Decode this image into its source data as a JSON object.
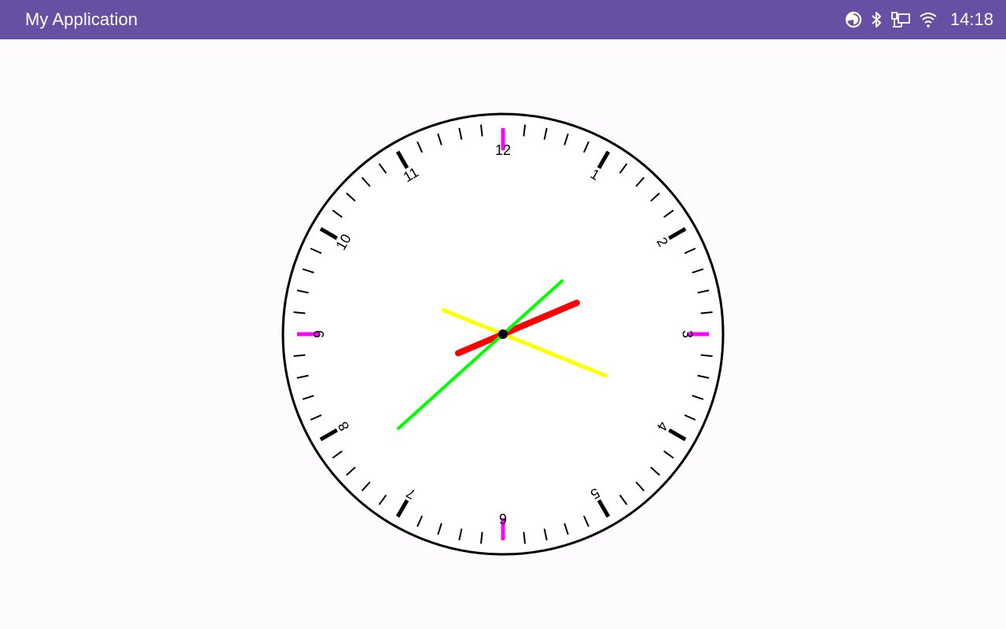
{
  "app_bar": {
    "title": "My Application",
    "background": "#6750a4"
  },
  "status_bar": {
    "time": "14:18",
    "icons": [
      "data-saver-icon",
      "bluetooth-icon",
      "ethernet-icon",
      "wifi-icon"
    ]
  },
  "clock": {
    "numerals": [
      "12",
      "1",
      "2",
      "3",
      "4",
      "5",
      "6",
      "7",
      "8",
      "9",
      "10",
      "11"
    ],
    "hour_hand_angle_deg": 67,
    "hour_hand_color": "#ff0000",
    "minute_hand_angle_deg": 112,
    "minute_hand_color": "#ffff00",
    "second_hand_angle_deg": 48,
    "second_hand_color": "#00ff00",
    "quarter_tick_color": "#ff00ff",
    "hour_tick_color": "#000000",
    "minute_tick_color": "#000000",
    "rim_color": "#000000",
    "face_color": "#ffffff"
  }
}
